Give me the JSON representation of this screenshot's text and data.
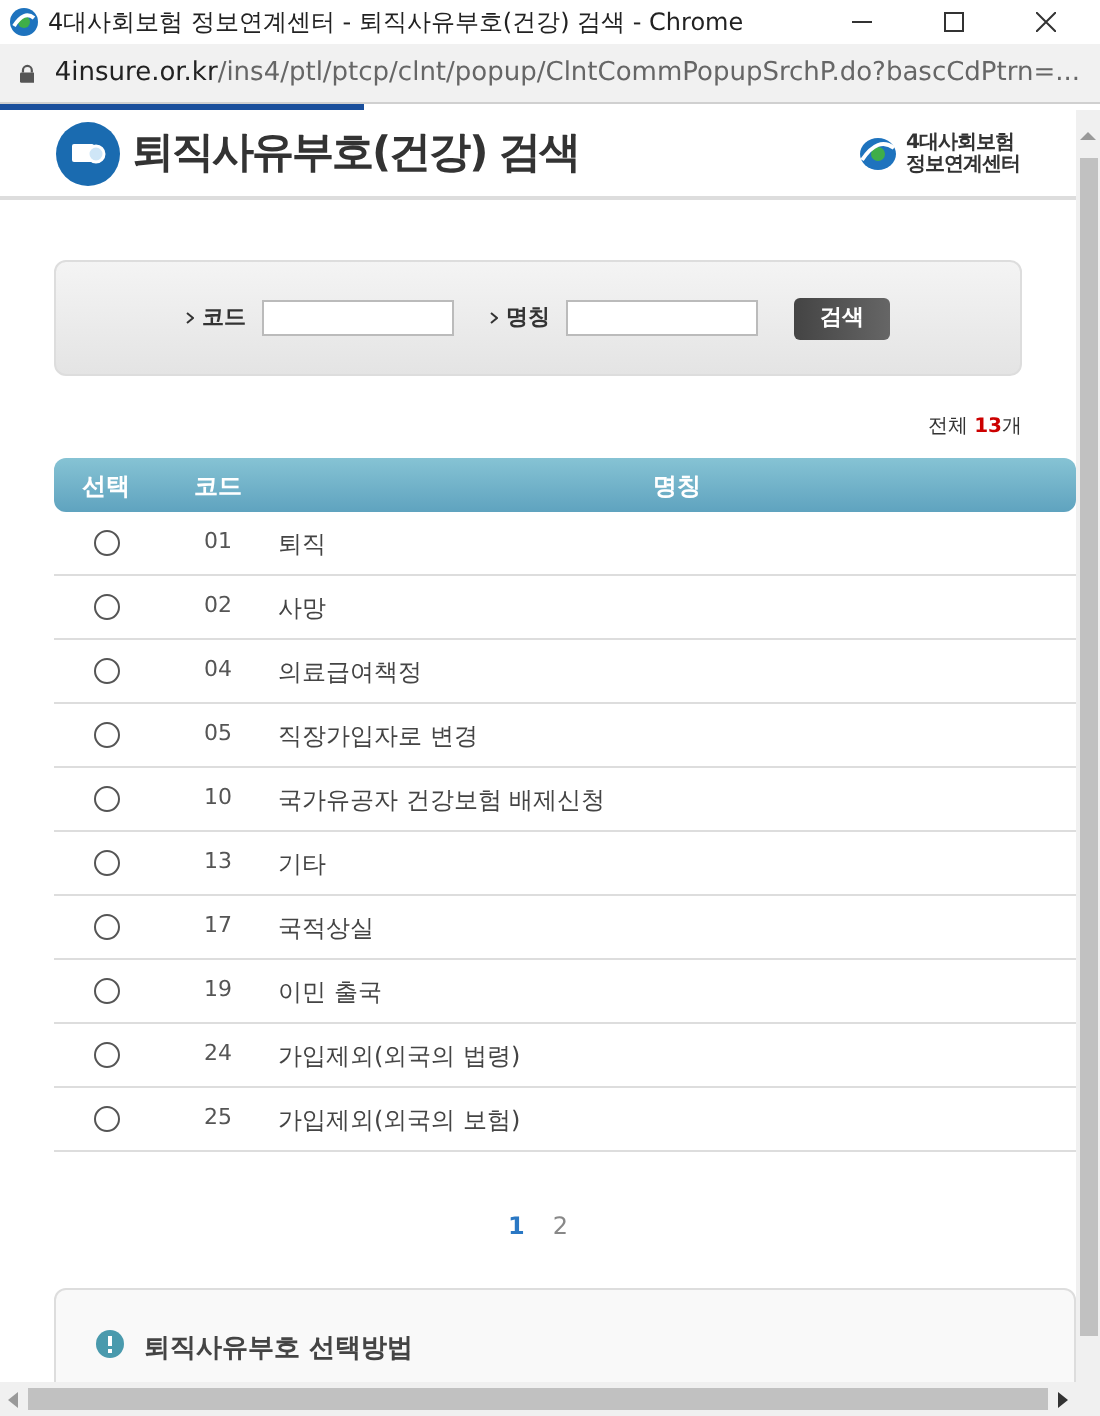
{
  "window": {
    "title": "4대사회보험 정보연계센터 - 퇴직사유부호(건강) 검색 - Chrome"
  },
  "address_bar": {
    "host": "4insure.or.kr",
    "path": "/ins4/ptl/ptcp/clnt/popup/ClntCommPopupSrchP.do?bascCdPtrn=..."
  },
  "loading": {
    "level": 0.33
  },
  "header": {
    "title": "퇴직사유부호(건강) 검색",
    "logo_lines": [
      "4대사회보험",
      "정보연계센터"
    ]
  },
  "search": {
    "fields": [
      {
        "label": "코드"
      },
      {
        "label": "명칭"
      }
    ],
    "button": "검색"
  },
  "count": {
    "prefix": "전체 ",
    "number": "13",
    "suffix": "개"
  },
  "table": {
    "columns": [
      "선택",
      "코드",
      "명칭"
    ],
    "rows": [
      {
        "code": "01",
        "name": "퇴직",
        "selected": false
      },
      {
        "code": "02",
        "name": "사망",
        "selected": false
      },
      {
        "code": "04",
        "name": "의료급여책정",
        "selected": false
      },
      {
        "code": "05",
        "name": "직장가입자로 변경",
        "selected": false
      },
      {
        "code": "10",
        "name": "국가유공자 건강보험 배제신청",
        "selected": false
      },
      {
        "code": "13",
        "name": "기타",
        "selected": false
      },
      {
        "code": "17",
        "name": "국적상실",
        "selected": false
      },
      {
        "code": "19",
        "name": "이민 출국",
        "selected": false
      },
      {
        "code": "24",
        "name": "가입제외(외국의 법령)",
        "selected": false
      },
      {
        "code": "25",
        "name": "가입제외(외국의 보험)",
        "selected": false
      }
    ]
  },
  "pagination": [
    {
      "label": "1",
      "selected": true
    },
    {
      "label": "2",
      "selected": false
    }
  ],
  "info": {
    "title": "퇴직사유부호 선택방법"
  }
}
